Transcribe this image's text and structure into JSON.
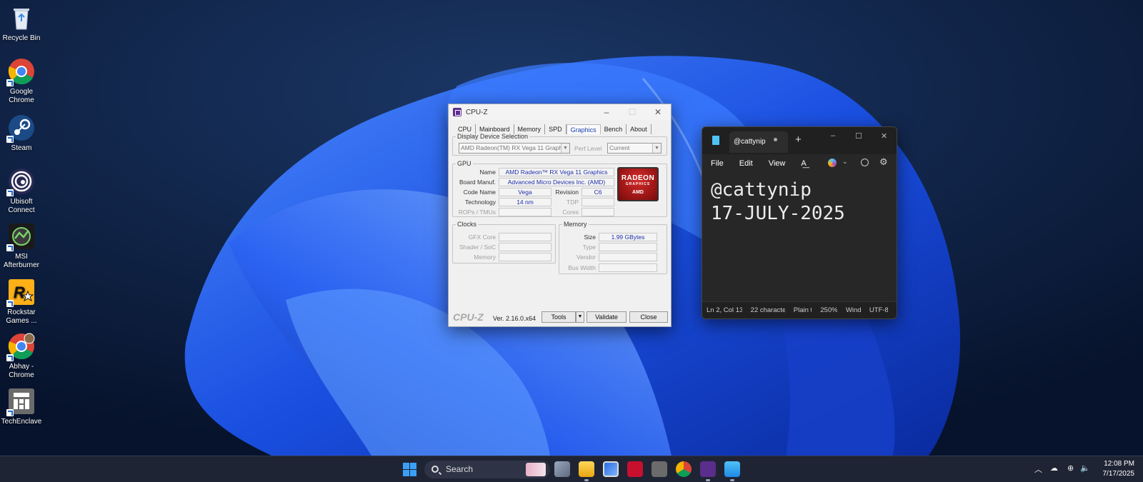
{
  "desktop": {
    "icons": [
      {
        "label": "Recycle Bin",
        "icon": "recycle-bin-icon"
      },
      {
        "label": "Google Chrome",
        "icon": "chrome-icon"
      },
      {
        "label": "Steam",
        "icon": "steam-icon"
      },
      {
        "label": "Ubisoft Connect",
        "icon": "ubisoft-icon"
      },
      {
        "label": "MSI Afterburner",
        "icon": "msi-afterburner-icon"
      },
      {
        "label": "Rockstar Games ...",
        "icon": "rockstar-icon"
      },
      {
        "label": "Abhay - Chrome",
        "icon": "chrome-profile-icon"
      },
      {
        "label": "TechEnclave",
        "icon": "techenclave-icon"
      }
    ]
  },
  "cpuz": {
    "title": "CPU-Z",
    "tabs": [
      "CPU",
      "Mainboard",
      "Memory",
      "SPD",
      "Graphics",
      "Bench",
      "About"
    ],
    "active_tab": "Graphics",
    "display_device": {
      "legend": "Display Device Selection",
      "device": "AMD Radeon(TM) RX Vega 11 Graphi",
      "perf_level_label": "Perf Level",
      "perf_level": "Current"
    },
    "gpu": {
      "legend": "GPU",
      "name_label": "Name",
      "name": "AMD Radeon™ RX Vega 11 Graphics",
      "board_label": "Board Manuf.",
      "board": "Advanced Micro Devices Inc. (AMD)",
      "code_label": "Code Name",
      "code": "Vega",
      "revision_label": "Revision",
      "revision": "C6",
      "tech_label": "Technology",
      "tech": "14 nm",
      "tdp_label": "TDP",
      "rops_label": "ROPs / TMUs",
      "cores_label": "Cores",
      "logo": {
        "line1": "RADEON",
        "line2": "GRAPHICS",
        "line3": "AMD"
      }
    },
    "clocks": {
      "legend": "Clocks",
      "gfx_label": "GFX Core",
      "shader_label": "Shader / SoC",
      "memory_label": "Memory"
    },
    "memory": {
      "legend": "Memory",
      "size_label": "Size",
      "size": "1.99 GBytes",
      "type_label": "Type",
      "vendor_label": "Vendor",
      "bus_label": "Bus Width"
    },
    "footer": {
      "brand": "CPU-Z",
      "version": "Ver. 2.16.0.x64",
      "tools": "Tools",
      "validate": "Validate",
      "close": "Close"
    }
  },
  "notepad": {
    "tab_title": "@cattynip",
    "menu": [
      "File",
      "Edit",
      "View"
    ],
    "lines": [
      "@cattynip",
      "17-JULY-2025"
    ],
    "status": {
      "position": "Ln 2, Col 13",
      "chars": "22 characte",
      "format": "Plain t",
      "zoom": "250%",
      "eol": "Wind",
      "encoding": "UTF-8"
    }
  },
  "taskbar": {
    "search_placeholder": "Search",
    "time": "12:08 PM",
    "date": "7/17/2025"
  }
}
